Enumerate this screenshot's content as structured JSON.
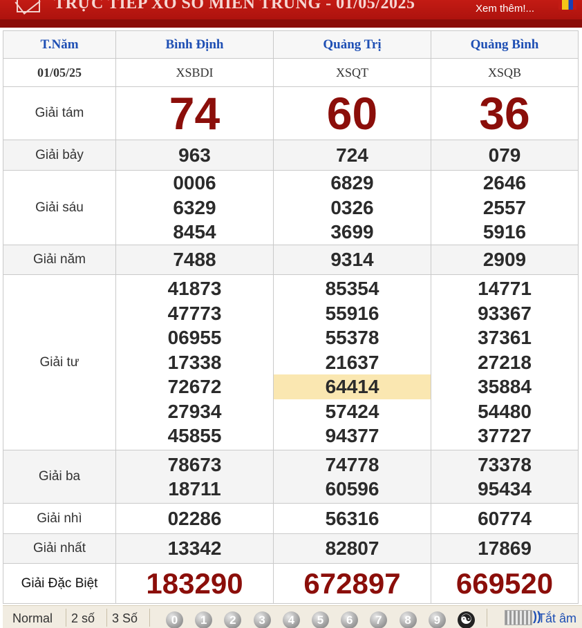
{
  "header": {
    "title": "TRỰC TIẾP XỔ SỐ MIỀN TRUNG - 01/05/2025",
    "more_link": "Xem thêm!..."
  },
  "table": {
    "col_header": "T.Năm",
    "date": "01/05/25",
    "provinces": [
      {
        "name": "Bình Định",
        "code": "XSBDI"
      },
      {
        "name": "Quảng Trị",
        "code": "XSQT"
      },
      {
        "name": "Quảng Bình",
        "code": "XSQB"
      }
    ],
    "prizes": [
      {
        "label": "Giải tám",
        "values": [
          [
            "74"
          ],
          [
            "60"
          ],
          [
            "36"
          ]
        ]
      },
      {
        "label": "Giải bảy",
        "values": [
          [
            "963"
          ],
          [
            "724"
          ],
          [
            "079"
          ]
        ]
      },
      {
        "label": "Giải sáu",
        "values": [
          [
            "0006",
            "6329",
            "8454"
          ],
          [
            "6829",
            "0326",
            "3699"
          ],
          [
            "2646",
            "2557",
            "5916"
          ]
        ]
      },
      {
        "label": "Giải năm",
        "values": [
          [
            "7488"
          ],
          [
            "9314"
          ],
          [
            "2909"
          ]
        ]
      },
      {
        "label": "Giải tư",
        "values": [
          [
            "41873",
            "47773",
            "06955",
            "17338",
            "72672",
            "27934",
            "45855"
          ],
          [
            "85354",
            "55916",
            "55378",
            "21637",
            "64414",
            "57424",
            "94377"
          ],
          [
            "14771",
            "93367",
            "37361",
            "27218",
            "35884",
            "54480",
            "37727"
          ]
        ]
      },
      {
        "label": "Giải ba",
        "values": [
          [
            "78673",
            "18711"
          ],
          [
            "74778",
            "60596"
          ],
          [
            "73378",
            "95434"
          ]
        ]
      },
      {
        "label": "Giải nhì",
        "values": [
          [
            "02286"
          ],
          [
            "56316"
          ],
          [
            "60774"
          ]
        ]
      },
      {
        "label": "Giải nhất",
        "values": [
          [
            "13342"
          ],
          [
            "82807"
          ],
          [
            "17869"
          ]
        ]
      },
      {
        "label": "Giải Đặc Biệt",
        "values": [
          [
            "183290"
          ],
          [
            "672897"
          ],
          [
            "669520"
          ]
        ]
      }
    ],
    "highlight_color": "#fae7b1",
    "special_color": "#8b0e0a",
    "header_color": "#1e4fb4"
  },
  "toolbar": {
    "normal": "Normal",
    "two_digits": "2 số",
    "three_digits": "3 Số",
    "digits": [
      "0",
      "1",
      "2",
      "3",
      "4",
      "5",
      "6",
      "7",
      "8",
      "9"
    ],
    "mute": "Tắt âm"
  }
}
